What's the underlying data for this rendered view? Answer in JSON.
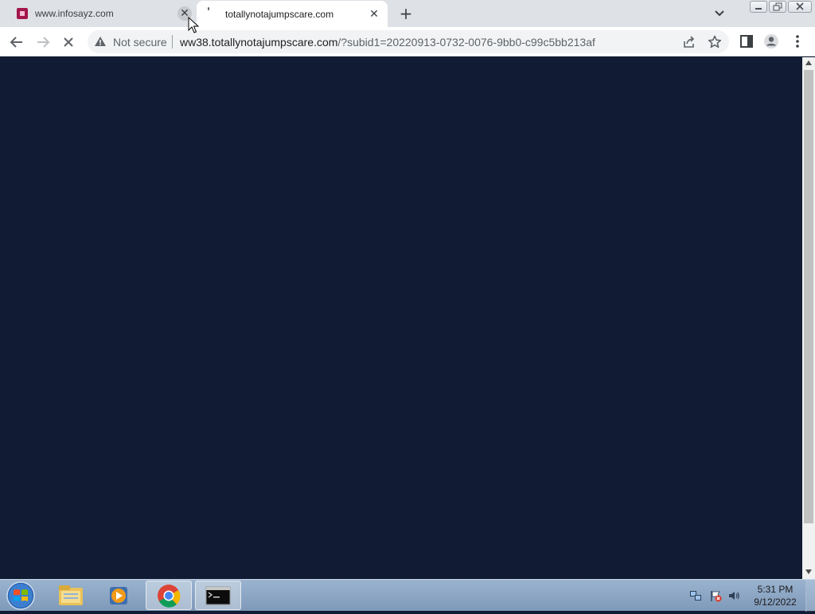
{
  "browser": {
    "tabs": [
      {
        "title": "www.infosayz.com",
        "active": false,
        "favicon": "infosayz-favicon-icon"
      },
      {
        "title": "totallynotajumpscare.com",
        "active": true,
        "favicon": "loading-favicon-icon"
      }
    ],
    "close_glyph": "✕",
    "new_tab_glyph": "+",
    "security_label": "Not secure",
    "url_host": "ww38.totallynotajumpscare.com",
    "url_rest": "/?subid1=20220913-0732-0076-9bb0-c99c5bb213af",
    "page_background": "#111b33"
  },
  "taskbar": {
    "items": [
      "windows-explorer-icon",
      "media-player-icon",
      "chrome-icon",
      "command-prompt-icon"
    ],
    "clock_time": "5:31 PM",
    "clock_date": "9/12/2022"
  }
}
